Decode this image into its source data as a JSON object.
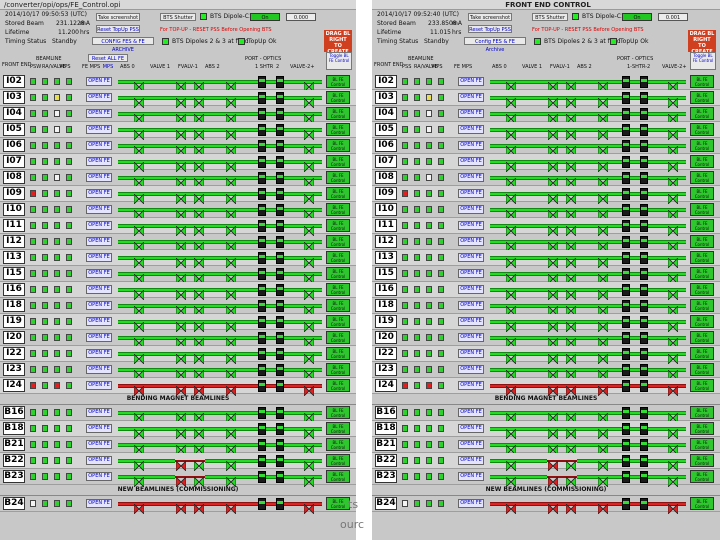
{
  "left_panel": {
    "title": "/converter/opi/ops/FE_Control.opi",
    "header": {
      "date_line": "2014/10/17 09:50:53   (UTC)",
      "stored_beam_label": "Stored Beam",
      "stored_beam_value": "231.1228",
      "stored_beam_unit": "mA",
      "lifetime_label": "Lifetime",
      "lifetime_value": "11.200",
      "lifetime_unit": "hrs",
      "timing_label": "Timing Status",
      "timing_value": "Standby",
      "btn_screenshot": "Take screenshot",
      "btn_reset": "Reset TopUp PSS",
      "btn_config": "CONFIG FES & FE ARCHIVE",
      "bts_shutter": "BTS Shutter",
      "bts_dipole": "BTS Dipole-C1",
      "on_text": "On",
      "value": "0.000",
      "warning": "For TOP-UP - RESET PSS Before Opening BTS",
      "dipoles": "BTS Dipoles 2 & 3 at field",
      "topup": "TopUp Ok",
      "drag": "DRAG BL RIGHT TO CREATE"
    },
    "cols": {
      "front_end": "FRONT END",
      "beamline": "BEAMLINE",
      "psw": "PSW",
      "ravalve": "RA/VALVE",
      "mps": "MPS",
      "fe_mps": "FE MPS",
      "abs0": "ABS 0",
      "valve1": "VALVE 1",
      "fvalve1": "FVALV-1",
      "abs2": "ABS 2",
      "port_optics": "PORT - OPTICS",
      "shtr": "1 SHTR",
      "two": "2",
      "valve2": "VALVE-2+",
      "toggle": "Toggle BL FE Control",
      "reset_all": "Reset ALL FE MPS"
    },
    "section_bending": "BENDING MAGNET BEAMLINES",
    "section_new": "NEW BEAMLINES (COMMISSIONING)"
  },
  "right_panel": {
    "title": "FRONT END CONTROL",
    "header": {
      "date_line": "2014/10/17 09:52:40   (UTC)",
      "stored_beam_label": "Stored Beam",
      "stored_beam_value": "233.8508",
      "stored_beam_unit": "mA",
      "lifetime_label": "Lifetime",
      "lifetime_value": "11.015",
      "lifetime_unit": "hrs",
      "timing_label": "Timing Status",
      "timing_value": "Standby",
      "btn_screenshot": "Take screenshot",
      "btn_reset": "Reset TopUp PSS",
      "btn_config": "Config FES & FE Archive",
      "bts_shutter": "BTS Shutter",
      "bts_dipole": "BTS Dipole-C1",
      "on_text": "On",
      "value": "0.001",
      "warning": "For TOP-UP - RESET PSS Before Opening BTS",
      "dipoles": "BTS Dipoles 2 & 3 at field",
      "topup": "TopUp Ok",
      "drag": "DRAG BL RIGHT TO CREATE"
    },
    "cols": {
      "front_end": "FRONT END",
      "beamline": "BEAMLINE",
      "psw": "PSS",
      "ravalve": "RA/VALVE",
      "mps": "MPS",
      "fe_mps": "FE MPS",
      "abs0": "ABS 0",
      "valve1": "VALVE 1",
      "fvalve1": "FVALV-1",
      "abs2": "ABS 2",
      "port_optics": "PORT - OPTICS",
      "shtr": "1-SHTR-2",
      "two": "",
      "valve2": "VALVE-2+",
      "toggle": "Toggle BL FE Control",
      "reset_all": ""
    },
    "section_bending": "BENDING MAGNET BEAMLINES",
    "section_new": "NEW BEAMLINES (COMMISSIONING)"
  },
  "rows": [
    {
      "name": "I02",
      "ind": [
        "g",
        "g",
        "g",
        "g"
      ],
      "state": "green"
    },
    {
      "name": "I03",
      "ind": [
        "g",
        "g",
        "y",
        "g"
      ],
      "state": "green"
    },
    {
      "name": "I04",
      "ind": [
        "g",
        "g",
        "w",
        "g"
      ],
      "state": "green"
    },
    {
      "name": "I05",
      "ind": [
        "g",
        "g",
        "w",
        "g"
      ],
      "state": "green"
    },
    {
      "name": "I06",
      "ind": [
        "g",
        "g",
        "g",
        "g"
      ],
      "state": "green"
    },
    {
      "name": "I07",
      "ind": [
        "g",
        "g",
        "g",
        "g"
      ],
      "state": "green"
    },
    {
      "name": "I08",
      "ind": [
        "g",
        "g",
        "w",
        "g"
      ],
      "state": "green"
    },
    {
      "name": "I09",
      "ind": [
        "r",
        "g",
        "g",
        "g"
      ],
      "state": "green"
    },
    {
      "name": "I10",
      "ind": [
        "g",
        "g",
        "g",
        "g"
      ],
      "state": "green"
    },
    {
      "name": "I11",
      "ind": [
        "g",
        "g",
        "g",
        "g"
      ],
      "state": "green"
    },
    {
      "name": "I12",
      "ind": [
        "g",
        "g",
        "g",
        "g"
      ],
      "state": "green"
    },
    {
      "name": "I13",
      "ind": [
        "g",
        "g",
        "g",
        "g"
      ],
      "state": "green"
    },
    {
      "name": "I15",
      "ind": [
        "g",
        "g",
        "g",
        "g"
      ],
      "state": "green"
    },
    {
      "name": "I16",
      "ind": [
        "g",
        "g",
        "g",
        "g"
      ],
      "state": "green"
    },
    {
      "name": "I18",
      "ind": [
        "g",
        "g",
        "g",
        "g"
      ],
      "state": "green"
    },
    {
      "name": "I19",
      "ind": [
        "g",
        "g",
        "g",
        "g"
      ],
      "state": "green"
    },
    {
      "name": "I20",
      "ind": [
        "g",
        "g",
        "g",
        "g"
      ],
      "state": "green"
    },
    {
      "name": "I22",
      "ind": [
        "g",
        "g",
        "g",
        "g"
      ],
      "state": "green"
    },
    {
      "name": "I23",
      "ind": [
        "g",
        "g",
        "g",
        "g"
      ],
      "state": "green"
    },
    {
      "name": "I24",
      "ind": [
        "r",
        "g",
        "r",
        "g"
      ],
      "state": "red"
    }
  ],
  "bending_rows": [
    {
      "name": "B16",
      "ind": [
        "g",
        "g",
        "g",
        "g"
      ],
      "state": "green"
    },
    {
      "name": "B18",
      "ind": [
        "g",
        "g",
        "g",
        "g"
      ],
      "state": "green"
    },
    {
      "name": "B21",
      "ind": [
        "g",
        "g",
        "g",
        "g"
      ],
      "state": "green"
    },
    {
      "name": "B22",
      "ind": [
        "g",
        "g",
        "g",
        "g"
      ],
      "state": "partial"
    },
    {
      "name": "B23",
      "ind": [
        "g",
        "g",
        "g",
        "g"
      ],
      "state": "partial"
    }
  ],
  "new_rows": [
    {
      "name": "B24",
      "ind": [
        "w",
        "g",
        "g",
        "g"
      ],
      "state": "red"
    }
  ],
  "open_fe_label": "OPEN FE",
  "bl_control_label": "BL FE Control",
  "overlays": {
    "a": "ts",
    "b": "ourc"
  }
}
